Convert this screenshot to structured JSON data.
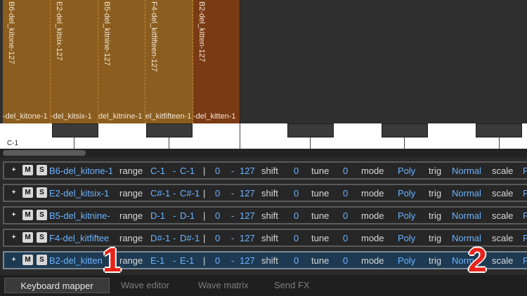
{
  "zones": [
    {
      "vertical_label": "B6-del_kitone-127",
      "bottom_label": "-del_kitone-1"
    },
    {
      "vertical_label": "E2-del_kitsix-127",
      "bottom_label": "-del_kitsix-1"
    },
    {
      "vertical_label": "B5-del_kitnine-127",
      "bottom_label": "del_kitnine-1"
    },
    {
      "vertical_label": "F4-del_kitfifteen-127",
      "bottom_label": "el_kitfifteen-1"
    },
    {
      "vertical_label": "B2-del_kitten-127",
      "bottom_label": "-del_kitten-1"
    }
  ],
  "keyboard": {
    "c1_label": "C-1"
  },
  "row_labels": {
    "range": "range",
    "dash": "-",
    "sep": "|",
    "shift": "shift",
    "tune": "tune",
    "mode": "mode",
    "trig": "trig",
    "scale": "scale",
    "m": "M",
    "s": "S",
    "plus": "+"
  },
  "rows": [
    {
      "name": "B6-del_kitone-1",
      "range_from": "C-1",
      "range_to": "C-1",
      "vel_lo": "0",
      "vel_hi": "127",
      "shift": "0",
      "tune": "0",
      "mode": "Poly",
      "trig": "Normal",
      "scale": "F"
    },
    {
      "name": "E2-del_kitsix-1",
      "range_from": "C#-1",
      "range_to": "C#-1",
      "vel_lo": "0",
      "vel_hi": "127",
      "shift": "0",
      "tune": "0",
      "mode": "Poly",
      "trig": "Normal",
      "scale": "F"
    },
    {
      "name": "B5-del_kitnine-",
      "range_from": "D-1",
      "range_to": "D-1",
      "vel_lo": "0",
      "vel_hi": "127",
      "shift": "0",
      "tune": "0",
      "mode": "Poly",
      "trig": "Normal",
      "scale": "F"
    },
    {
      "name": "F4-del_kitfiftee",
      "range_from": "D#-1",
      "range_to": "D#-1",
      "vel_lo": "0",
      "vel_hi": "127",
      "shift": "0",
      "tune": "0",
      "mode": "Poly",
      "trig": "Normal",
      "scale": "F"
    },
    {
      "name": "B2-del_kitten",
      "range_from": "E-1",
      "range_to": "E-1",
      "vel_lo": "0",
      "vel_hi": "127",
      "shift": "0",
      "tune": "0",
      "mode": "Poly",
      "trig": "Normal",
      "scale": "F"
    }
  ],
  "annotations": {
    "one": "1",
    "two": "2"
  },
  "tabs": [
    "Keyboard mapper",
    "Wave editor",
    "Wave matrix",
    "Send FX"
  ],
  "colors": {
    "zone_gold": "#8b5d1f",
    "zone_rust": "#7a3a14",
    "value_blue": "#6bb3ff",
    "annotation_red": "#e8221a",
    "selected_row": "#1e3a52"
  }
}
